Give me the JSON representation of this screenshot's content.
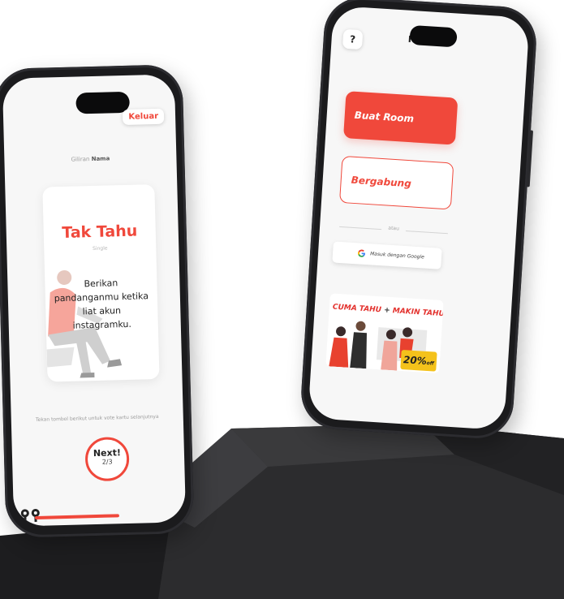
{
  "left_phone": {
    "exit_label": "Keluar",
    "turn_prefix": "Giliran",
    "turn_name": "Nama",
    "card": {
      "title": "Tak Tahu",
      "subtitle": "Single",
      "question": "Berikan pandanganmu ketika liat akun instagramku."
    },
    "hint": "Tekan tombol berikut untuk vote kartu selanjutnya",
    "next": {
      "label": "Next!",
      "count": "2/3"
    },
    "progress": 0.67
  },
  "right_phone": {
    "help_label": "?",
    "title_partial": "H              n",
    "create_room_label": "Buat Room",
    "join_label": "Bergabung",
    "or_label": "atau",
    "google_label": "Masuk dengan Google",
    "promo": {
      "part1": "CUMA TAHU",
      "plus": "+",
      "part2": "MAKIN TAHU",
      "discount": "20%",
      "discount_suffix": "off"
    }
  },
  "colors": {
    "accent": "#f0483b",
    "badge": "#f4c21b",
    "phone_body": "#1b1b1d",
    "pedestal": "#2a2a2c"
  },
  "icons": [
    "google-icon",
    "person-illustration",
    "app-logo-icon"
  ]
}
